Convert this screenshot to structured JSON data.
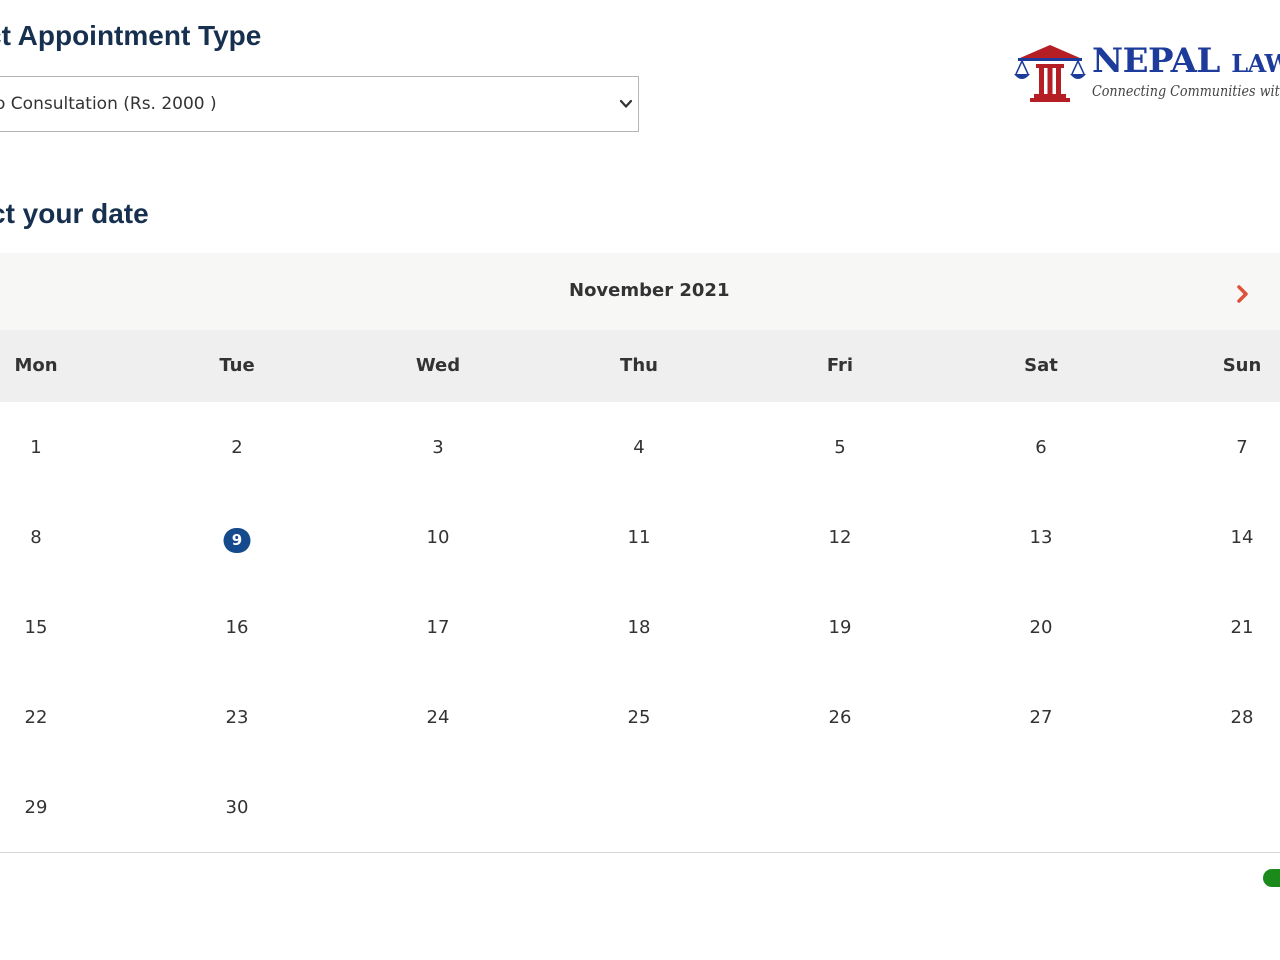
{
  "appointment": {
    "heading": "ct Appointment Type",
    "selected_option": "o Consultation (Rs. 2000 )"
  },
  "logo": {
    "title_main": "NEPAL",
    "title_small": "LAWY",
    "tagline": "Connecting Communities with Legal"
  },
  "date": {
    "heading": "ct your date"
  },
  "calendar": {
    "month": "November 2021",
    "weekdays": [
      "Mon",
      "Tue",
      "Wed",
      "Thu",
      "Fri",
      "Sat",
      "Sun"
    ],
    "weeks": [
      [
        "1",
        "2",
        "3",
        "4",
        "5",
        "6",
        "7"
      ],
      [
        "8",
        "9",
        "10",
        "11",
        "12",
        "13",
        "14"
      ],
      [
        "15",
        "16",
        "17",
        "18",
        "19",
        "20",
        "21"
      ],
      [
        "22",
        "23",
        "24",
        "25",
        "26",
        "27",
        "28"
      ],
      [
        "29",
        "30"
      ]
    ],
    "selected_day": "9",
    "accent_color": "#154b8c",
    "arrow_color": "#e0513a"
  },
  "icons": {
    "next": "chevron-right-icon",
    "dropdown": "chevron-down-icon"
  }
}
